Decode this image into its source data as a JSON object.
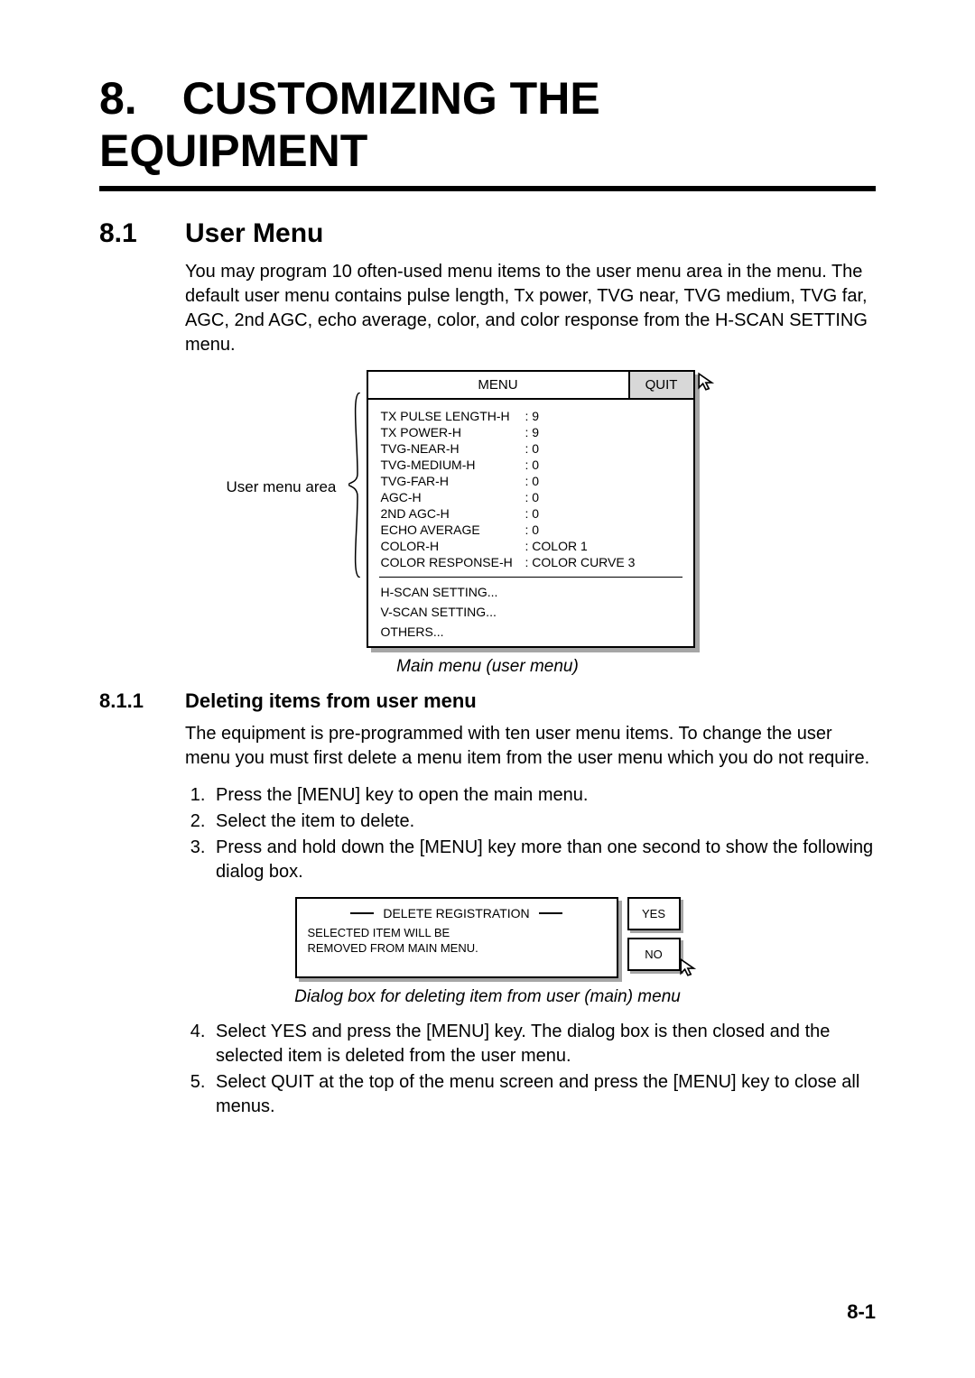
{
  "chapter": {
    "num": "8.",
    "title": "CUSTOMIZING THE EQUIPMENT"
  },
  "section": {
    "num": "8.1",
    "title": "User Menu",
    "intro": "You may program 10 often-used menu items to the user menu area in the menu. The default user menu contains pulse length, Tx power, TVG near, TVG medium, TVG far, AGC, 2nd AGC, echo average, color, and color response from the H-SCAN SETTING menu."
  },
  "figure1": {
    "user_label": "User menu area",
    "menu_title": "MENU",
    "quit": "QUIT",
    "items": [
      {
        "label": "TX PULSE LENGTH-H",
        "value": ": 9"
      },
      {
        "label": "TX POWER-H",
        "value": ": 9"
      },
      {
        "label": "TVG-NEAR-H",
        "value": ": 0"
      },
      {
        "label": "TVG-MEDIUM-H",
        "value": ": 0"
      },
      {
        "label": "TVG-FAR-H",
        "value": ": 0"
      },
      {
        "label": "AGC-H",
        "value": ": 0"
      },
      {
        "label": "2ND AGC-H",
        "value": ": 0"
      },
      {
        "label": "ECHO AVERAGE",
        "value": ": 0"
      },
      {
        "label": "COLOR-H",
        "value": ": COLOR 1"
      },
      {
        "label": "COLOR RESPONSE-H",
        "value": ": COLOR CURVE 3"
      }
    ],
    "footer": [
      "H-SCAN SETTING...",
      "V-SCAN SETTING...",
      "OTHERS..."
    ],
    "caption": "Main menu (user menu)"
  },
  "subsection": {
    "num": "8.1.1",
    "title": "Deleting items from user menu",
    "intro": "The equipment is pre-programmed with ten user menu items. To change the user menu you must first delete a menu item from the user menu which you do not require.",
    "steps_a": [
      "Press the [MENU] key to open the main menu.",
      "Select the item to delete.",
      "Press and hold down the [MENU] key more than one second to show the following dialog box."
    ],
    "dialog": {
      "title": "DELETE REGISTRATION",
      "line1": "SELECTED ITEM WILL BE",
      "line2": "REMOVED FROM MAIN MENU.",
      "yes": "YES",
      "no": "NO"
    },
    "caption2": "Dialog box for deleting item from user (main) menu",
    "steps_b": [
      "Select YES and press the [MENU] key. The dialog box is then closed and the selected item is deleted from the user menu.",
      "Select QUIT at the top of the menu screen and press the [MENU] key to close all menus."
    ]
  },
  "page_number": "8-1"
}
